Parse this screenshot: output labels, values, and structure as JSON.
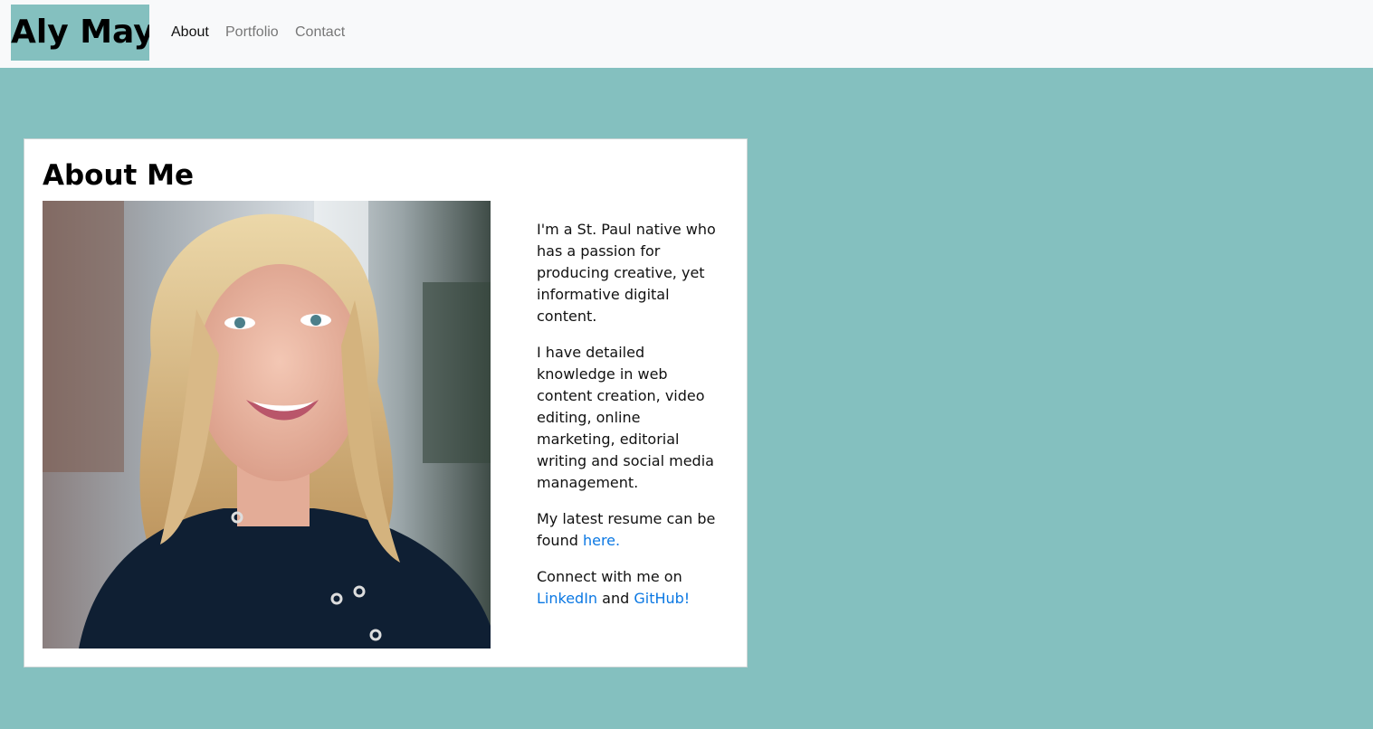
{
  "navbar": {
    "brand": "Aly May",
    "links": [
      {
        "label": "About"
      },
      {
        "label": "Portfolio"
      },
      {
        "label": "Contact"
      }
    ]
  },
  "about": {
    "title": "About Me",
    "photo_alt": "Portrait of Aly May",
    "p1": "I'm a St. Paul native who has a passion for producing creative, yet informative digital content.",
    "p2": "I have detailed knowledge in web content creation, video editing, online marketing, editorial writing and social media management.",
    "p3_text": "My latest resume can be found ",
    "p3_link": "here.",
    "p4_text": "Connect with me on ",
    "p4_link1": "LinkedIn",
    "p4_and": " and ",
    "p4_link2": "GitHub!"
  },
  "colors": {
    "page_background": "#84c0bf",
    "navbar_background": "#f8f9fa",
    "link": "#0b78e3"
  }
}
